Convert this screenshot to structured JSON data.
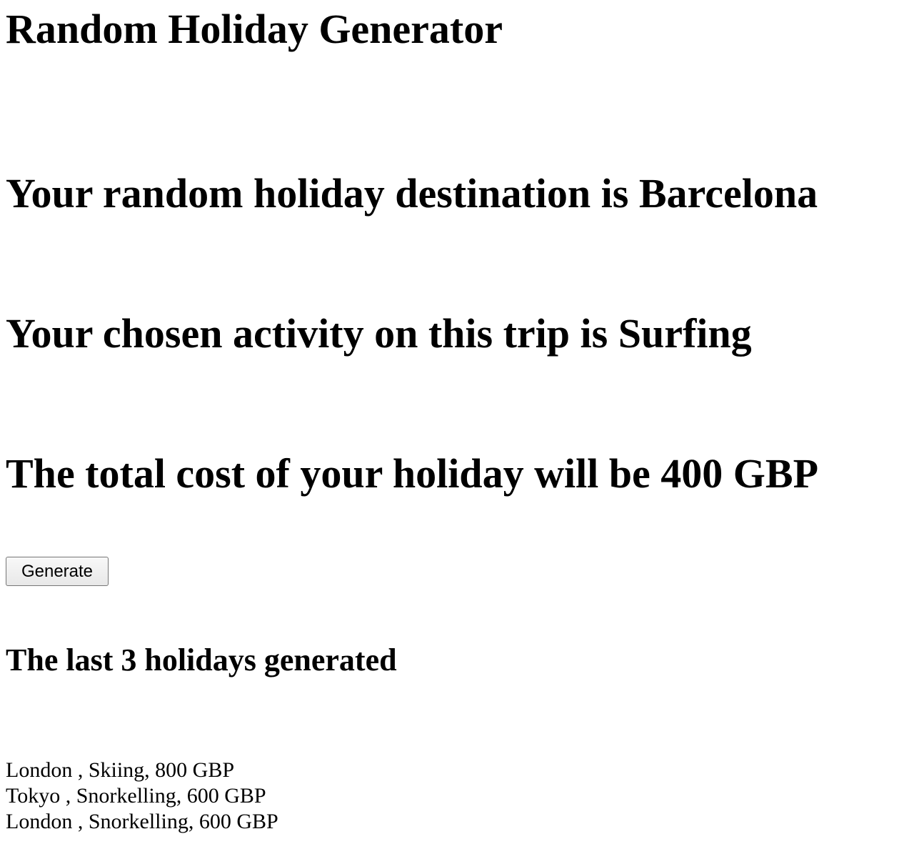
{
  "page": {
    "title": "Random Holiday Generator"
  },
  "result": {
    "destination_text": "Your random holiday destination is Barcelona",
    "activity_text": "Your chosen activity on this trip is Surfing",
    "cost_text": "The total cost of your holiday will be 400 GBP"
  },
  "controls": {
    "generate_label": "Generate"
  },
  "history": {
    "heading": "The last 3 holidays generated",
    "items": [
      "London , Skiing, 800 GBP",
      "Tokyo , Snorkelling, 600 GBP",
      "London , Snorkelling, 600 GBP"
    ]
  }
}
